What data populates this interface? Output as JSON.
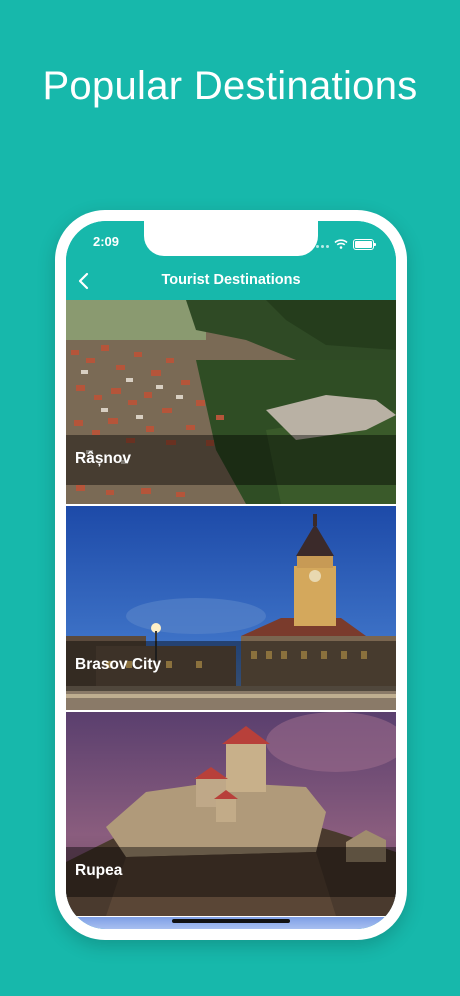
{
  "headline": "Popular Destinations",
  "status_bar": {
    "time": "2:09"
  },
  "nav": {
    "title": "Tourist Destinations"
  },
  "destinations": [
    {
      "name": "Râșnov"
    },
    {
      "name": "Brasov City"
    },
    {
      "name": "Rupea"
    }
  ],
  "colors": {
    "background": "#17b8ab",
    "accent": "#17b8ab",
    "text": "#ffffff"
  }
}
